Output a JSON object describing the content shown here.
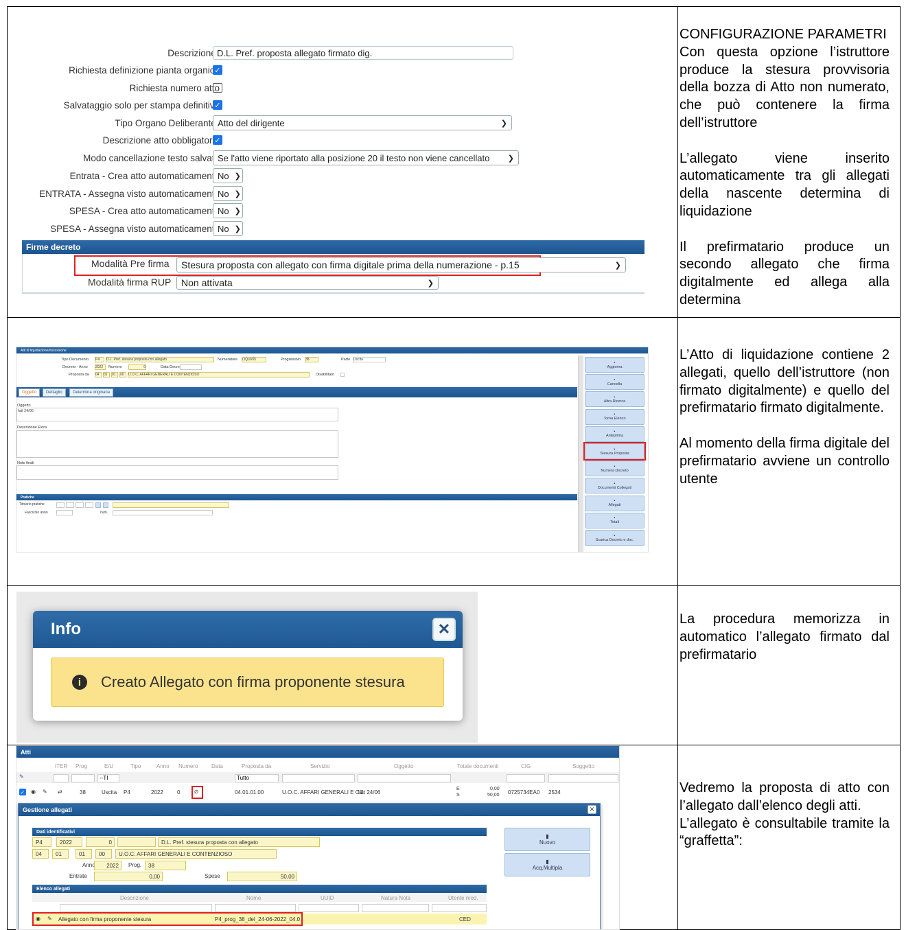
{
  "sections": [
    {
      "description": [
        "CONFIGURAZIONE PARAMETRI",
        "Con questa opzione l’istruttore produce la stesura provvisoria della bozza di Atto non numerato, che può contenere la firma dell’istruttore",
        "L’allegato viene inserito automaticamente tra gli allegati della nascente determina di liquidazione",
        "Il prefirmatario produce un secondo allegato che firma digitalmente ed allega alla determina"
      ]
    },
    {
      "description": [
        "L’Atto di liquidazione contiene 2 allegati, quello dell’istruttore (non firmato digitalmente) e quello del prefirmatario firmato digitalmente.",
        "Al momento della firma digitale del prefirmatario avviene un controllo utente"
      ]
    },
    {
      "description": [
        "La procedura memorizza in automatico l’allegato firmato dal prefirmatario"
      ]
    },
    {
      "description": [
        "Vedremo la proposta di atto con l’allegato dall’elenco degli atti.",
        "L’allegato è consultabile tramite la “graffetta”:"
      ]
    }
  ],
  "config_form": {
    "fields": [
      {
        "label": "Descrizione",
        "required": true,
        "type": "input",
        "value": "D.L. Pref. proposta allegato firmato dig."
      },
      {
        "label": "Richiesta definizione pianta organica",
        "type": "checkbox",
        "checked": true
      },
      {
        "label": "Richiesta numero atto",
        "type": "checkbox",
        "checked": false
      },
      {
        "label": "Salvataggio solo per stampa definitiva",
        "type": "checkbox",
        "checked": true
      },
      {
        "label": "Tipo Organo Deliberante",
        "required": true,
        "type": "select",
        "value": "Atto del dirigente"
      },
      {
        "label": "Descrizione atto obbligatoria",
        "type": "checkbox",
        "checked": true
      },
      {
        "label": "Modo cancellazione testo salvato",
        "type": "select",
        "value": "Se l'atto viene riportato alla posizione 20 il testo non viene cancellato"
      },
      {
        "label": "Entrata - Crea atto automaticamente",
        "type": "select",
        "value": "No"
      },
      {
        "label": "ENTRATA - Assegna visto automaticamente",
        "type": "select",
        "value": "No"
      },
      {
        "label": "SPESA - Crea atto automaticamente",
        "type": "select",
        "value": "No"
      },
      {
        "label": "SPESA - Assegna visto automaticamente",
        "type": "select",
        "value": "No"
      }
    ],
    "firme_header": "Firme decreto",
    "pre_firma_label": "Modalità Pre firma",
    "pre_firma_value": "Stesura proposta con allegato con firma digitale prima della numerazione - p.15",
    "rup_label": "Modalità firma RUP",
    "rup_value": "Non attivata"
  },
  "atto_screen": {
    "title": "Atti di liquidazione/riscossione",
    "tipo_doc_label": "Tipo Documento",
    "tipo_doc": "P4",
    "tipo_doc_desc": "D.L. Pref. stesura proposta con allegato",
    "numeratore_label": "Numeratore",
    "numeratore": "LIQUI/65",
    "progressivo_label": "Progressivo",
    "progressivo": "38",
    "parte_label": "Parte",
    "parte": "Uscita",
    "decreto_label": "Decreto - Anno",
    "anno": "2022",
    "numero_label": "Numero",
    "numero": "0",
    "data_decreto_label": "Data Decreto",
    "proposta_label": "Proposta da",
    "proposta_codes": [
      "04",
      "01",
      "01",
      "00"
    ],
    "proposta_desc": "U.O.C. AFFARI GENERALI E CONTENZIOSO",
    "disabilitato_label": "Disabilitato",
    "tabs": [
      "Oggetto",
      "Dettaglio",
      "Determina originaria"
    ],
    "oggetto_label": "Oggetto",
    "oggetto_value": "fatt 24/06",
    "descrizione_extra_label": "Descrizione Extra",
    "note_finali_label": "Note finali",
    "pratiche_header": "Pratiche",
    "titolario_label": "Titolario pratiche",
    "fascicolo_label": "Fascicolo anno",
    "num_label": "num.",
    "side_buttons": [
      "Aggiorna",
      "Cancella",
      "Altra Ricerca",
      "Torna Elenco",
      "Anteprima",
      "Stesura Proposta",
      "Numera Decreto",
      "Documenti Collegati",
      "Allegati",
      "Totali",
      "Scarica Decreto e doc."
    ]
  },
  "info_dialog": {
    "title": "Info",
    "message": "Creato Allegato con firma proponente stesura"
  },
  "atti_list": {
    "title": "Atti",
    "columns": [
      "ITER",
      "Prog",
      "E/U",
      "Tipo",
      "Anno",
      "Numero",
      "Data",
      "Proposta da",
      "Servizio",
      "Oggetto",
      "Totale documenti",
      "CIG",
      "Soggetto"
    ],
    "filter_eu": "--TI",
    "filter_proposta": "Tutto",
    "row": {
      "prog": "38",
      "eu": "Uscita",
      "tipo": "P4",
      "anno": "2022",
      "numero": "0",
      "proposta": "04.01.01.00",
      "servizio": "U.O.C. AFFARI GENERALI E CO",
      "oggetto": "fatt 24/06",
      "tot_e": "0,00",
      "tot_s": "50,00",
      "tot_e_label": "E",
      "tot_s_label": "S",
      "cig": "0725734EA0",
      "soggetto": "2534"
    }
  },
  "gestione_allegati": {
    "title": "Gestione allegati",
    "dati_header": "Dati identificativi",
    "tipo": "P4",
    "anno": "2022",
    "numero": "0",
    "tipo_desc": "D.L. Pref. stesura proposta con allegato",
    "codes": [
      "04",
      "01",
      "01",
      "00"
    ],
    "ufficio": "U.O.C. AFFARI GENERALI E CONTENZIOSO",
    "anno_label": "Anno",
    "anno_val": "2022",
    "prog_label": "Prog.",
    "prog_val": "38",
    "entrate_label": "Entrate",
    "entrate_val": "0,00",
    "spese_label": "Spese",
    "spese_val": "50,00",
    "elenco_header": "Elenco allegati",
    "columns": [
      "Descrizione",
      "Nome",
      "UUID",
      "Natura Nota",
      "Utente mod."
    ],
    "row": {
      "descrizione": "Allegato con firma proponente stesura",
      "nome": "P4_prog_38_del_24-06-2022_04.0",
      "utente": "CED"
    },
    "buttons": [
      "Nuovo",
      "Acq.Multipla"
    ]
  }
}
